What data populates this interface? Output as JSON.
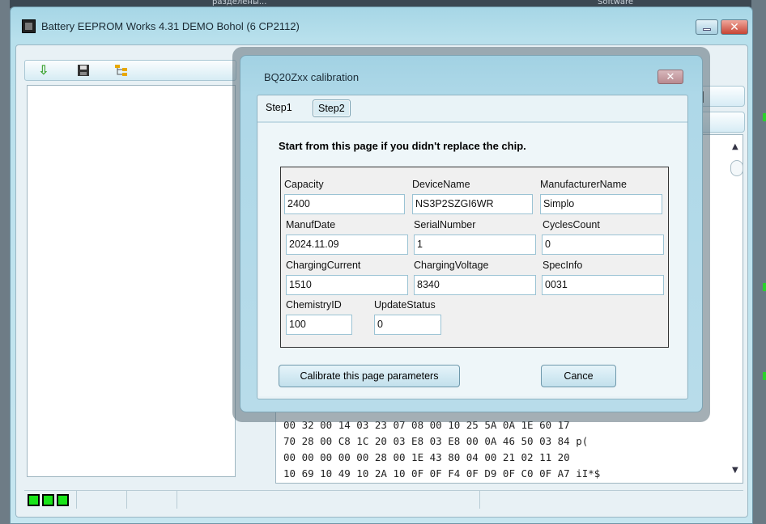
{
  "desktop": {
    "top_texts": [
      "разделены...",
      "Software"
    ]
  },
  "window": {
    "title": "Battery EEPROM Works  4.31 DEMO Bohol (6 CP2112)",
    "min_label": "",
    "close_label": "✕"
  },
  "toolbar": {
    "items": [
      "arrow-down-icon",
      "save-icon",
      "tree-icon"
    ]
  },
  "hex_dump": {
    "lines": [
      "00 32 00 14 03 23 07 08 00 10 25 5A 0A 1E 60 17",
      "70 28 00 C8 1C 20 03 E8 03 E8 00 0A 46 50 03 84 p(",
      "00 00 00 00 00 28 00 1E 43 80 04 00 21 02 11 20",
      "10 69 10 49 10 2A 10 0F 0F F4 0F D9 0F C0 0F A7 ͏i͏I͏*͏͏͏͏͏͏͏͏͏͏͏͏$"
    ]
  },
  "dialog": {
    "title": "BQ20Zxx calibration",
    "close_label": "✕",
    "tabs": [
      {
        "label": "Step1",
        "selected": false
      },
      {
        "label": "Step2",
        "selected": true
      }
    ],
    "headline": "Start from this page if you didn't replace the chip.",
    "fields": {
      "capacity": {
        "label": "Capacity",
        "value": "2400"
      },
      "device_name": {
        "label": "DeviceName",
        "value": "NS3P2SZGI6WR"
      },
      "manufacturer_name": {
        "label": "ManufacturerName",
        "value": "Simplo"
      },
      "manuf_date": {
        "label": "ManufDate",
        "value": "2024.11.09"
      },
      "serial_number": {
        "label": "SerialNumber",
        "value": "1"
      },
      "cycles_count": {
        "label": "CyclesCount",
        "value": "0"
      },
      "charging_current": {
        "label": "ChargingCurrent",
        "value": "1510"
      },
      "charging_voltage": {
        "label": "ChargingVoltage",
        "value": "8340"
      },
      "spec_info": {
        "label": "SpecInfo",
        "value": "0031"
      },
      "chemistry_id": {
        "label": "ChemistryID",
        "value": "100"
      },
      "update_status": {
        "label": "UpdateStatus",
        "value": "0"
      }
    },
    "buttons": {
      "calibrate": "Calibrate this page parameters",
      "cancel": "Cance"
    }
  },
  "status": {
    "battery_cells": 3
  },
  "colors": {
    "window_bg": "#b8e0ec",
    "battery_green": "#19e419",
    "close_red": "#c64434"
  }
}
